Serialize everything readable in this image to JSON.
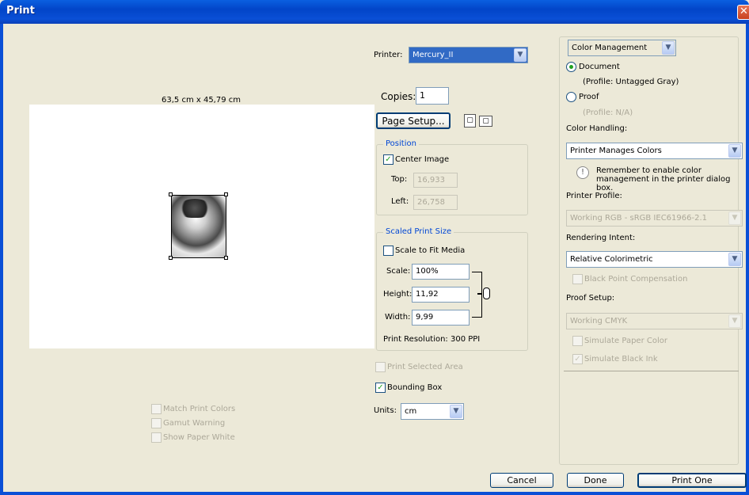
{
  "window": {
    "title": "Print",
    "close_symbol": "✕"
  },
  "preview": {
    "paper_size": "63,5 cm x 45,79 cm",
    "options": {
      "match_print_colors": "Match Print Colors",
      "gamut_warning": "Gamut Warning",
      "show_paper_white": "Show Paper White"
    }
  },
  "printer": {
    "label": "Printer:",
    "value": "Mercury_II"
  },
  "copies": {
    "label": "Copies:",
    "value": "1"
  },
  "page_setup": {
    "label": "Page Setup...",
    "icon_a": "portrait-orientation-icon",
    "icon_b": "landscape-orientation-icon"
  },
  "position": {
    "title": "Position",
    "center_image": {
      "label": "Center Image",
      "checked": true
    },
    "top": {
      "label": "Top:",
      "value": "16,933"
    },
    "left": {
      "label": "Left:",
      "value": "26,758"
    }
  },
  "scaled": {
    "title": "Scaled Print Size",
    "scale_to_fit": {
      "label": "Scale to Fit Media",
      "checked": false
    },
    "scale": {
      "label": "Scale:",
      "value": "100%"
    },
    "height": {
      "label": "Height:",
      "value": "11,92"
    },
    "width": {
      "label": "Width:",
      "value": "9,99"
    },
    "resolution": "Print Resolution: 300 PPI"
  },
  "print_selected_area": "Print Selected Area",
  "bounding_box": {
    "label": "Bounding Box",
    "checked": true
  },
  "units": {
    "label": "Units:",
    "value": "cm"
  },
  "color": {
    "mode": "Color Management",
    "document": {
      "label": "Document",
      "checked": true
    },
    "document_profile": "(Profile: Untagged Gray)",
    "proof": {
      "label": "Proof",
      "checked": false
    },
    "proof_profile": "(Profile: N/A)",
    "handling_label": "Color Handling:",
    "handling_value": "Printer Manages Colors",
    "reminder": "Remember to enable color management in the printer dialog box.",
    "printer_profile_label": "Printer Profile:",
    "printer_profile_value": "Working RGB - sRGB IEC61966-2.1",
    "rendering_intent_label": "Rendering Intent:",
    "rendering_intent_value": "Relative Colorimetric",
    "black_point": "Black Point Compensation",
    "proof_setup_label": "Proof Setup:",
    "proof_setup_value": "Working CMYK",
    "simulate_paper": "Simulate Paper Color",
    "simulate_ink": "Simulate Black Ink"
  },
  "buttons": {
    "cancel": "Cancel",
    "done": "Done",
    "print_one": "Print One"
  },
  "colors": {
    "title_bar": "#0245c8",
    "dialog_bg": "#ece9d8",
    "group_label": "#0046d5"
  }
}
